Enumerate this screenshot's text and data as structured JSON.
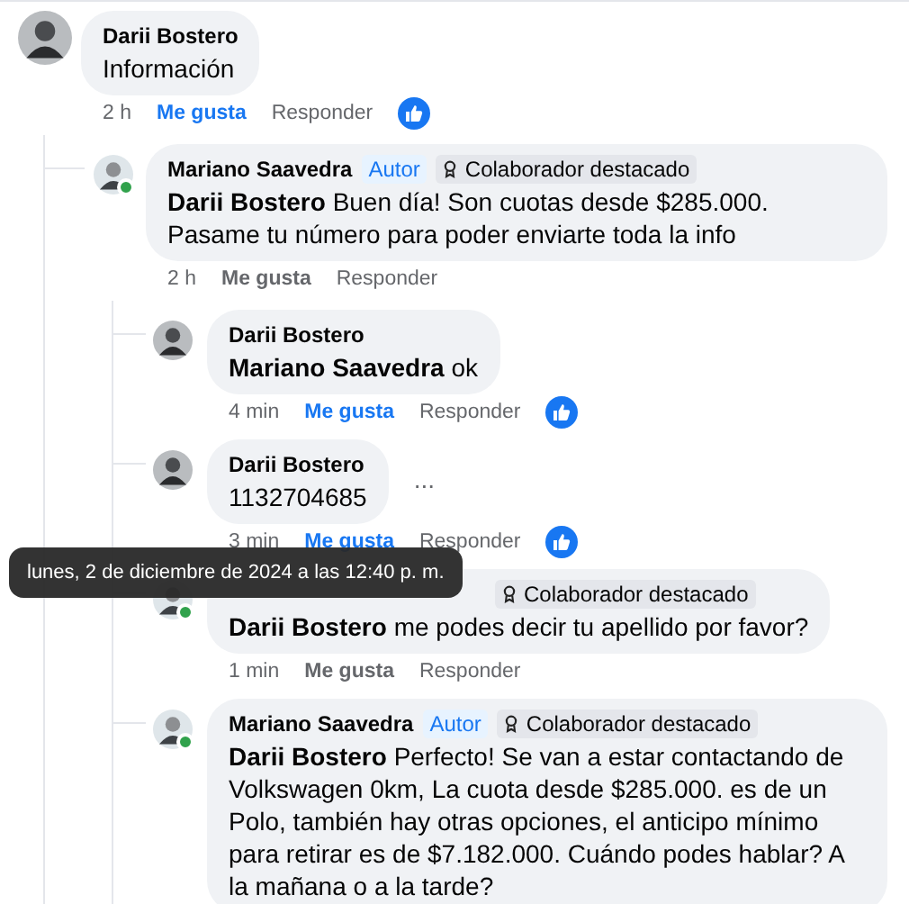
{
  "comments": [
    {
      "author": "Darii Bostero",
      "text": "Información",
      "online": false,
      "time": "2 h",
      "like_label": "Me gusta",
      "liked": true,
      "reply_label": "Responder",
      "reaction": true,
      "children": [
        {
          "author": "Mariano Saavedra",
          "author_badge": "Autor",
          "contributor_badge": "Colaborador destacado",
          "mention": "Darii Bostero",
          "text": "Buen día! Son cuotas desde $285.000. Pasame tu número para poder enviarte toda la info",
          "online": true,
          "time": "2 h",
          "like_label": "Me gusta",
          "liked": false,
          "reply_label": "Responder",
          "reaction": false,
          "children": [
            {
              "author": "Darii Bostero",
              "mention": "Mariano Saavedra",
              "text": "ok",
              "online": false,
              "time": "4 min",
              "like_label": "Me gusta",
              "liked": true,
              "reply_label": "Responder",
              "reaction": true
            },
            {
              "author": "Darii Bostero",
              "text": "1132704685",
              "more": "...",
              "online": false,
              "time": "3 min",
              "like_label": "Me gusta",
              "liked": true,
              "reply_label": "Responder",
              "reaction": true
            },
            {
              "contributor_badge": "Colaborador destacado",
              "mention": "Darii Bostero",
              "text": "me podes decir tu apellido por favor?",
              "online": true,
              "time": "1 min",
              "like_label": "Me gusta",
              "liked": false,
              "reply_label": "Responder",
              "reaction": false
            },
            {
              "author": "Mariano Saavedra",
              "author_badge": "Autor",
              "contributor_badge": "Colaborador destacado",
              "mention": "Darii Bostero",
              "text": "Perfecto! Se van a estar contactando de Volkswagen 0km, La cuota desde $285.000. es de un Polo, también hay otras opciones, el anticipo mínimo para retirar es de $7.182.000. Cuándo podes hablar? A la mañana o a la tarde?",
              "online": true
            }
          ]
        }
      ]
    }
  ],
  "tooltip": {
    "text": "lunes, 2 de diciembre de 2024 a las 12:40 p. m."
  }
}
